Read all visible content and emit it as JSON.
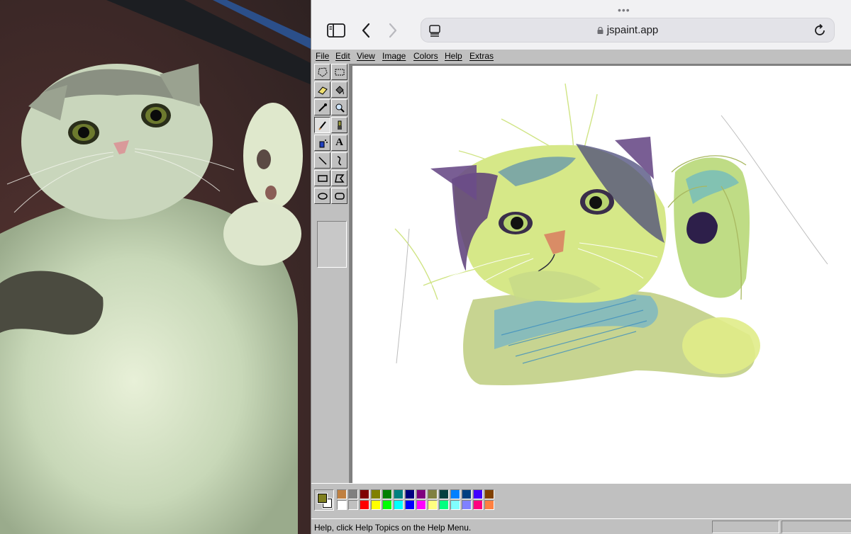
{
  "browser": {
    "url": "jspaint.app",
    "grabber": "•••"
  },
  "menu": [
    {
      "label": "File"
    },
    {
      "label": "Edit"
    },
    {
      "label": "View"
    },
    {
      "label": "Image"
    },
    {
      "label": "Colors"
    },
    {
      "label": "Help"
    },
    {
      "label": "Extras"
    }
  ],
  "tools": [
    {
      "name": "free-form-select-tool",
      "icon": "free-form-select-icon"
    },
    {
      "name": "select-tool",
      "icon": "select-icon"
    },
    {
      "name": "eraser-tool",
      "icon": "eraser-icon"
    },
    {
      "name": "fill-tool",
      "icon": "fill-bucket-icon"
    },
    {
      "name": "pick-color-tool",
      "icon": "eyedropper-icon"
    },
    {
      "name": "magnifier-tool",
      "icon": "magnifier-icon"
    },
    {
      "name": "pencil-tool",
      "icon": "pencil-icon",
      "active": true
    },
    {
      "name": "brush-tool",
      "icon": "brush-icon"
    },
    {
      "name": "airbrush-tool",
      "icon": "airbrush-icon"
    },
    {
      "name": "text-tool",
      "icon": "text-icon"
    },
    {
      "name": "line-tool",
      "icon": "line-icon"
    },
    {
      "name": "curve-tool",
      "icon": "curve-icon"
    },
    {
      "name": "rectangle-tool",
      "icon": "rectangle-icon"
    },
    {
      "name": "polygon-tool",
      "icon": "polygon-icon"
    },
    {
      "name": "ellipse-tool",
      "icon": "ellipse-icon"
    },
    {
      "name": "rounded-rectangle-tool",
      "icon": "rounded-rectangle-icon"
    }
  ],
  "colors": {
    "foreground": "#808020",
    "background": "#ffffff",
    "palette_top": [
      "#c08040",
      "#808080",
      "#800000",
      "#808000",
      "#008000",
      "#008080",
      "#000080",
      "#800080",
      "#808040",
      "#004040",
      "#0080ff",
      "#004080",
      "#4000ff",
      "#804000"
    ],
    "palette_bottom": [
      "#ffffff",
      "#c0c0c0",
      "#ff0000",
      "#ffff00",
      "#00ff00",
      "#00ffff",
      "#0000ff",
      "#ff00ff",
      "#ffff80",
      "#00ff80",
      "#80ffff",
      "#8080ff",
      "#ff0080",
      "#ff8040"
    ]
  },
  "status": {
    "text": "Help, click Help Topics on the Help Menu."
  }
}
